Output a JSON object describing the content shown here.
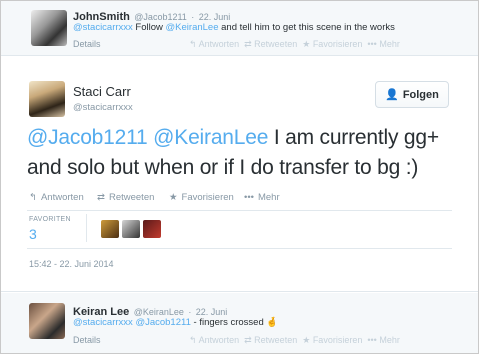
{
  "top_tweet": {
    "name": "JohnSmith",
    "handle": "@Jacob1211",
    "date": "22. Juni",
    "mention1": "@stacicarrxxx",
    "text_mid": " Follow ",
    "mention2": "@KeiranLee",
    "text_end": " and tell him to get this scene in the works",
    "details": "Details",
    "actions": [
      "Antworten",
      "Retweeten",
      "Favorisieren",
      "Mehr"
    ]
  },
  "main_tweet": {
    "name": "Staci Carr",
    "handle": "@stacicarrxxx",
    "follow_label": "Folgen",
    "mention1": "@Jacob1211",
    "mention2": "@KeiranLee",
    "text": " I am currently gg+ and solo but when or if I do transfer to bg :)",
    "actions": {
      "reply": "Antworten",
      "retweet": "Retweeten",
      "favorite": "Favorisieren",
      "more": "Mehr"
    },
    "favorites_label": "FAVORITEN",
    "favorites_count": "3",
    "timestamp": "15:42 - 22. Juni 2014"
  },
  "reply_tweet": {
    "name": "Keiran Lee",
    "handle": "@KeiranLee",
    "date": "22. Juni",
    "mention1": "@stacicarrxxx",
    "mention2": "@Jacob1211",
    "text": " - fingers crossed",
    "emoji": "🤞",
    "details": "Details",
    "actions": [
      "Antworten",
      "Retweeten",
      "Favorisieren",
      "Mehr"
    ]
  },
  "colors": {
    "link": "#55acee",
    "muted": "#8899a6",
    "text": "#292f33",
    "bg_alt": "#f5f8fa"
  },
  "icons": [
    "reply-icon",
    "retweet-icon",
    "star-icon",
    "more-icon",
    "follow-user-icon"
  ]
}
